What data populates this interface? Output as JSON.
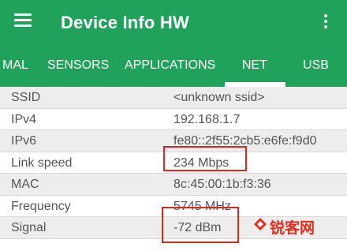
{
  "app": {
    "title": "Device Info HW",
    "icons": {
      "menu": "menu-icon",
      "overflow": "more-vert-icon"
    },
    "colors": {
      "toolbar": "#20a25b",
      "highlight": "#e0261f",
      "watermark": "#e52b1b"
    }
  },
  "tabs": [
    {
      "label": "MAL",
      "active": false
    },
    {
      "label": "SENSORS",
      "active": false
    },
    {
      "label": "APPLICATIONS",
      "active": false
    },
    {
      "label": "NET",
      "active": true
    },
    {
      "label": "USB",
      "active": false
    }
  ],
  "net_info": [
    {
      "label": "SSID",
      "value": "<unknown ssid>"
    },
    {
      "label": "IPv4",
      "value": "192.168.1.7"
    },
    {
      "label": "IPv6",
      "value": "fe80::2f55:2cb5:e6fe:f9d0"
    },
    {
      "label": "Link speed",
      "value": "234 Mbps",
      "highlighted": true
    },
    {
      "label": "MAC",
      "value": "8c:45:00:1b:f3:36"
    },
    {
      "label": "Frequency",
      "value": "5745 MHz"
    },
    {
      "label": "Signal",
      "value": "-72 dBm",
      "highlighted": true
    }
  ],
  "watermark": {
    "text": "锐客网"
  }
}
